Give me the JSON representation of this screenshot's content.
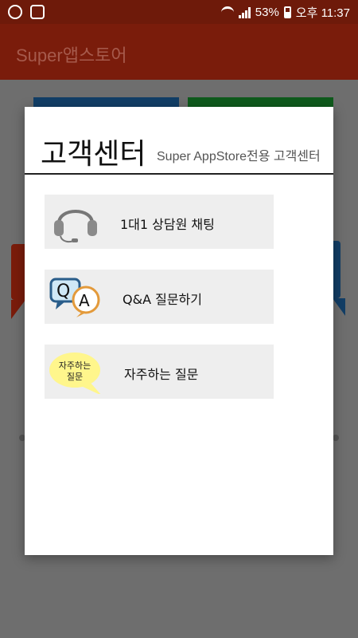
{
  "status_bar": {
    "battery": "53%",
    "time": "오후 11:37"
  },
  "app_bar": {
    "title": "Super앱스토어"
  },
  "dialog": {
    "title": "고객센터",
    "subtitle": "Super AppStore전용 고객센터",
    "items": [
      {
        "label": "1대1 상담원 채팅",
        "icon": "headset-icon"
      },
      {
        "label": "Q&A 질문하기",
        "icon": "qa-speech-bubbles-icon"
      },
      {
        "label": "자주하는 질문",
        "icon": "faq-bubble-icon",
        "icon_text": "자주하는 질문"
      }
    ]
  },
  "colors": {
    "status_bar": "#6e1a0a",
    "app_bar": "#7a1c0b",
    "overlay": "#6e6e6e",
    "dialog_bg": "#ffffff",
    "item_bg": "#eeeeee",
    "faq_bubble": "#fff68c"
  }
}
